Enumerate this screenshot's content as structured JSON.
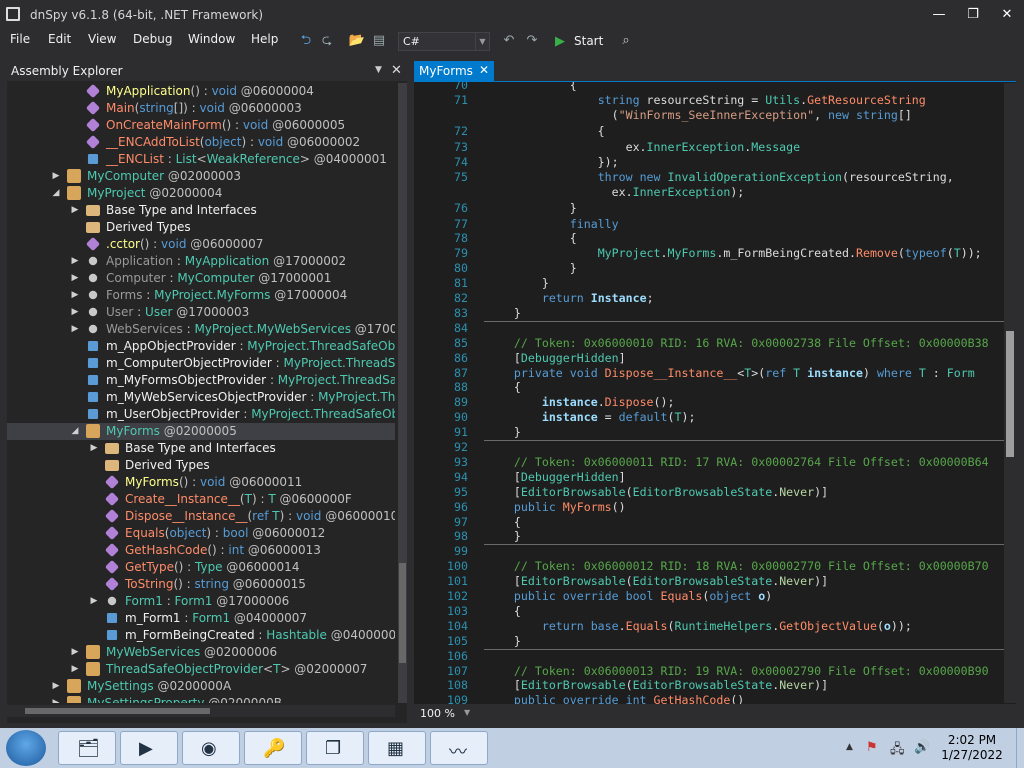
{
  "window": {
    "title": "dnSpy v6.1.8 (64-bit, .NET Framework)",
    "min": "—",
    "max": "❐",
    "close": "✕"
  },
  "menu": [
    "File",
    "Edit",
    "View",
    "Debug",
    "Window",
    "Help"
  ],
  "toolbar": {
    "language": "C#",
    "start_label": "Start"
  },
  "assembly_explorer": {
    "title": "Assembly Explorer",
    "nodes": [
      {
        "indent": 5,
        "arrow": "",
        "icon": "method-icon",
        "color": "#b180d7",
        "parts": [
          [
            "MyApplication",
            "c-m"
          ],
          [
            "() : ",
            "c-p"
          ],
          [
            "void",
            "c-k"
          ],
          [
            " @06000004",
            "c-p"
          ]
        ]
      },
      {
        "indent": 5,
        "arrow": "",
        "icon": "method-icon",
        "color": "#b180d7",
        "parts": [
          [
            "Main",
            "c-mb"
          ],
          [
            "(",
            "c-p"
          ],
          [
            "string",
            "c-k"
          ],
          [
            "[]) : ",
            "c-p"
          ],
          [
            "void",
            "c-k"
          ],
          [
            " @06000003",
            "c-p"
          ]
        ]
      },
      {
        "indent": 5,
        "arrow": "",
        "icon": "method-icon",
        "color": "#b180d7",
        "parts": [
          [
            "OnCreateMainForm",
            "c-mb"
          ],
          [
            "() : ",
            "c-p"
          ],
          [
            "void",
            "c-k"
          ],
          [
            " @06000005",
            "c-p"
          ]
        ]
      },
      {
        "indent": 5,
        "arrow": "",
        "icon": "method-icon",
        "color": "#b180d7",
        "parts": [
          [
            "__ENCAddToList",
            "c-mb"
          ],
          [
            "(",
            "c-p"
          ],
          [
            "object",
            "c-k"
          ],
          [
            ") : ",
            "c-p"
          ],
          [
            "void",
            "c-k"
          ],
          [
            " @06000002",
            "c-p"
          ]
        ]
      },
      {
        "indent": 5,
        "arrow": "",
        "icon": "field-icon",
        "color": "#5b9bd5",
        "parts": [
          [
            "__ENCList",
            "c-mb"
          ],
          [
            " : ",
            "c-p"
          ],
          [
            "List",
            "c-ty"
          ],
          [
            "<",
            "c-p"
          ],
          [
            "WeakReference",
            "c-ty"
          ],
          [
            "> @04000001",
            "c-p"
          ]
        ]
      },
      {
        "indent": 4,
        "arrow": "▶",
        "icon": "class-icon",
        "color": "#d7a65a",
        "parts": [
          [
            "MyComputer",
            "c-ty"
          ],
          [
            " @02000003",
            "c-p"
          ]
        ]
      },
      {
        "indent": 4,
        "arrow": "◢",
        "icon": "class-icon",
        "color": "#d7a65a",
        "parts": [
          [
            "MyProject",
            "c-ty"
          ],
          [
            " @02000004",
            "c-p"
          ]
        ]
      },
      {
        "indent": 5,
        "arrow": "▶",
        "icon": "folder-icon",
        "color": "#dcb67a",
        "parts": [
          [
            "Base Type and Interfaces",
            "c-wh"
          ]
        ]
      },
      {
        "indent": 5,
        "arrow": "",
        "icon": "folder-icon",
        "color": "#dcb67a",
        "parts": [
          [
            "Derived Types",
            "c-wh"
          ]
        ]
      },
      {
        "indent": 5,
        "arrow": "",
        "icon": "method-icon",
        "color": "#b180d7",
        "parts": [
          [
            ".cctor",
            "c-m"
          ],
          [
            "() : ",
            "c-p"
          ],
          [
            "void",
            "c-k"
          ],
          [
            " @06000007",
            "c-p"
          ]
        ]
      },
      {
        "indent": 5,
        "arrow": "▶",
        "icon": "wrench-icon",
        "color": "#c8c8c8",
        "parts": [
          [
            "Application",
            "c-pr"
          ],
          [
            " : ",
            "c-p"
          ],
          [
            "MyApplication",
            "c-ty"
          ],
          [
            " @17000002",
            "c-p"
          ]
        ]
      },
      {
        "indent": 5,
        "arrow": "▶",
        "icon": "wrench-icon",
        "color": "#c8c8c8",
        "parts": [
          [
            "Computer",
            "c-pr"
          ],
          [
            " : ",
            "c-p"
          ],
          [
            "MyComputer",
            "c-ty"
          ],
          [
            " @17000001",
            "c-p"
          ]
        ]
      },
      {
        "indent": 5,
        "arrow": "▶",
        "icon": "wrench-icon",
        "color": "#c8c8c8",
        "parts": [
          [
            "Forms",
            "c-pr"
          ],
          [
            " : ",
            "c-p"
          ],
          [
            "MyProject.MyForms",
            "c-ty"
          ],
          [
            " @17000004",
            "c-p"
          ]
        ]
      },
      {
        "indent": 5,
        "arrow": "▶",
        "icon": "wrench-icon",
        "color": "#c8c8c8",
        "parts": [
          [
            "User",
            "c-pr"
          ],
          [
            " : ",
            "c-p"
          ],
          [
            "User",
            "c-ty"
          ],
          [
            " @17000003",
            "c-p"
          ]
        ]
      },
      {
        "indent": 5,
        "arrow": "▶",
        "icon": "wrench-icon",
        "color": "#c8c8c8",
        "parts": [
          [
            "WebServices",
            "c-pr"
          ],
          [
            " : ",
            "c-p"
          ],
          [
            "MyProject.MyWebServices",
            "c-ty"
          ],
          [
            " @1700000",
            "c-p"
          ]
        ]
      },
      {
        "indent": 5,
        "arrow": "",
        "icon": "field-icon",
        "color": "#5b9bd5",
        "parts": [
          [
            "m_AppObjectProvider",
            "c-wh"
          ],
          [
            " : ",
            "c-p"
          ],
          [
            "MyProject.ThreadSafeObje",
            "c-ty"
          ]
        ]
      },
      {
        "indent": 5,
        "arrow": "",
        "icon": "field-icon",
        "color": "#5b9bd5",
        "parts": [
          [
            "m_ComputerObjectProvider",
            "c-wh"
          ],
          [
            " : ",
            "c-p"
          ],
          [
            "MyProject.ThreadSaf",
            "c-ty"
          ]
        ]
      },
      {
        "indent": 5,
        "arrow": "",
        "icon": "field-icon",
        "color": "#5b9bd5",
        "parts": [
          [
            "m_MyFormsObjectProvider",
            "c-wh"
          ],
          [
            " : ",
            "c-p"
          ],
          [
            "MyProject.ThreadSafe",
            "c-ty"
          ]
        ]
      },
      {
        "indent": 5,
        "arrow": "",
        "icon": "field-icon",
        "color": "#5b9bd5",
        "parts": [
          [
            "m_MyWebServicesObjectProvider",
            "c-wh"
          ],
          [
            " : ",
            "c-p"
          ],
          [
            "MyProject.Thre",
            "c-ty"
          ]
        ]
      },
      {
        "indent": 5,
        "arrow": "",
        "icon": "field-icon",
        "color": "#5b9bd5",
        "parts": [
          [
            "m_UserObjectProvider",
            "c-wh"
          ],
          [
            " : ",
            "c-p"
          ],
          [
            "MyProject.ThreadSafeObje",
            "c-ty"
          ]
        ]
      },
      {
        "indent": 5,
        "arrow": "◢",
        "icon": "class-icon",
        "color": "#d7a65a",
        "sel": true,
        "parts": [
          [
            "MyForms",
            "c-ty"
          ],
          [
            " @02000005",
            "c-p"
          ]
        ]
      },
      {
        "indent": 6,
        "arrow": "▶",
        "icon": "folder-icon",
        "color": "#dcb67a",
        "parts": [
          [
            "Base Type and Interfaces",
            "c-wh"
          ]
        ]
      },
      {
        "indent": 6,
        "arrow": "",
        "icon": "folder-icon",
        "color": "#dcb67a",
        "parts": [
          [
            "Derived Types",
            "c-wh"
          ]
        ]
      },
      {
        "indent": 6,
        "arrow": "",
        "icon": "method-icon",
        "color": "#b180d7",
        "parts": [
          [
            "MyForms",
            "c-m"
          ],
          [
            "() : ",
            "c-p"
          ],
          [
            "void",
            "c-k"
          ],
          [
            " @06000011",
            "c-p"
          ]
        ]
      },
      {
        "indent": 6,
        "arrow": "",
        "icon": "method-icon",
        "color": "#b180d7",
        "parts": [
          [
            "Create__Instance__",
            "c-mb"
          ],
          [
            "(",
            "c-p"
          ],
          [
            "T",
            "c-ty"
          ],
          [
            ") : ",
            "c-p"
          ],
          [
            "T",
            "c-ty"
          ],
          [
            " @0600000F",
            "c-p"
          ]
        ]
      },
      {
        "indent": 6,
        "arrow": "",
        "icon": "method-icon",
        "color": "#b180d7",
        "parts": [
          [
            "Dispose__Instance__",
            "c-mb"
          ],
          [
            "(",
            "c-p"
          ],
          [
            "ref",
            "c-k"
          ],
          [
            " ",
            "c-p"
          ],
          [
            "T",
            "c-ty"
          ],
          [
            ") : ",
            "c-p"
          ],
          [
            "void",
            "c-k"
          ],
          [
            " @06000010",
            "c-p"
          ]
        ]
      },
      {
        "indent": 6,
        "arrow": "",
        "icon": "method-icon",
        "color": "#b180d7",
        "parts": [
          [
            "Equals",
            "c-mb"
          ],
          [
            "(",
            "c-p"
          ],
          [
            "object",
            "c-k"
          ],
          [
            ") : ",
            "c-p"
          ],
          [
            "bool",
            "c-k"
          ],
          [
            " @06000012",
            "c-p"
          ]
        ]
      },
      {
        "indent": 6,
        "arrow": "",
        "icon": "method-icon",
        "color": "#b180d7",
        "parts": [
          [
            "GetHashCode",
            "c-mb"
          ],
          [
            "() : ",
            "c-p"
          ],
          [
            "int",
            "c-k"
          ],
          [
            " @06000013",
            "c-p"
          ]
        ]
      },
      {
        "indent": 6,
        "arrow": "",
        "icon": "method-icon",
        "color": "#b180d7",
        "parts": [
          [
            "GetType",
            "c-mb"
          ],
          [
            "() : ",
            "c-p"
          ],
          [
            "Type",
            "c-ty"
          ],
          [
            " @06000014",
            "c-p"
          ]
        ]
      },
      {
        "indent": 6,
        "arrow": "",
        "icon": "method-icon",
        "color": "#b180d7",
        "parts": [
          [
            "ToString",
            "c-mb"
          ],
          [
            "() : ",
            "c-p"
          ],
          [
            "string",
            "c-k"
          ],
          [
            " @06000015",
            "c-p"
          ]
        ]
      },
      {
        "indent": 6,
        "arrow": "▶",
        "icon": "wrench-icon",
        "color": "#c8c8c8",
        "parts": [
          [
            "Form1",
            "c-ty"
          ],
          [
            " : ",
            "c-p"
          ],
          [
            "Form1",
            "c-ty"
          ],
          [
            " @17000006",
            "c-p"
          ]
        ]
      },
      {
        "indent": 6,
        "arrow": "",
        "icon": "field-icon",
        "color": "#5b9bd5",
        "parts": [
          [
            "m_Form1",
            "c-wh"
          ],
          [
            " : ",
            "c-p"
          ],
          [
            "Form1",
            "c-ty"
          ],
          [
            " @04000007",
            "c-p"
          ]
        ]
      },
      {
        "indent": 6,
        "arrow": "",
        "icon": "field-icon",
        "color": "#5b9bd5",
        "parts": [
          [
            "m_FormBeingCreated",
            "c-wh"
          ],
          [
            " : ",
            "c-p"
          ],
          [
            "Hashtable",
            "c-ty"
          ],
          [
            " @04000008",
            "c-p"
          ]
        ]
      },
      {
        "indent": 5,
        "arrow": "▶",
        "icon": "class-icon",
        "color": "#d7a65a",
        "parts": [
          [
            "MyWebServices",
            "c-ty"
          ],
          [
            " @02000006",
            "c-p"
          ]
        ]
      },
      {
        "indent": 5,
        "arrow": "▶",
        "icon": "generic-class-icon",
        "color": "#d7a65a",
        "parts": [
          [
            "ThreadSafeObjectProvider",
            "c-ty"
          ],
          [
            "<",
            "c-p"
          ],
          [
            "T",
            "c-ty"
          ],
          [
            "> @02000007",
            "c-p"
          ]
        ]
      },
      {
        "indent": 4,
        "arrow": "▶",
        "icon": "class-icon",
        "color": "#d7a65a",
        "parts": [
          [
            "MySettings",
            "c-ty"
          ],
          [
            " @0200000A",
            "c-p"
          ]
        ]
      },
      {
        "indent": 4,
        "arrow": "▶",
        "icon": "class-icon",
        "color": "#d7a65a",
        "parts": [
          [
            "MySettingsProperty",
            "c-ty"
          ],
          [
            " @0200000B",
            "c-p"
          ]
        ]
      }
    ]
  },
  "editor": {
    "tab_label": "MyForms",
    "zoom": "100 %",
    "lines": [
      {
        "n": "70",
        "h": "            {"
      },
      {
        "n": "71",
        "h": "                <k>string</k> resourceString = <ty>Utils</ty>.<mt>GetResourceString</mt>"
      },
      {
        "n": "",
        "h": "                  (<st>\"WinForms_SeeInnerException\"</st>, <k>new string</k>[]"
      },
      {
        "n": "72",
        "h": "                {"
      },
      {
        "n": "73",
        "h": "                    ex.<pr>InnerException</pr>.<pr>Message</pr>"
      },
      {
        "n": "74",
        "h": "                });"
      },
      {
        "n": "75",
        "h": "                <k>throw new</k> <ty>InvalidOperationException</ty>(resourceString,"
      },
      {
        "n": "",
        "h": "                  ex.<pr>InnerException</pr>);"
      },
      {
        "n": "76",
        "h": "            }"
      },
      {
        "n": "77",
        "h": "            <k>finally</k>"
      },
      {
        "n": "78",
        "h": "            {"
      },
      {
        "n": "79",
        "h": "                <ty>MyProject</ty>.<ty>MyForms</ty>.m_FormBeingCreated.<mt>Remove</mt>(<k>typeof</k>(<tg>T</tg>));"
      },
      {
        "n": "80",
        "h": "            }"
      },
      {
        "n": "81",
        "h": "        }"
      },
      {
        "n": "82",
        "h": "        <k>return</k> <pm>Instance</pm>;"
      },
      {
        "n": "83",
        "h": "    }",
        "sep": true
      },
      {
        "n": "84",
        "h": ""
      },
      {
        "n": "85",
        "h": "    <cm>// Token: 0x06000010 RID: 16 RVA: 0x00002738 File Offset: 0x00000B38</cm>"
      },
      {
        "n": "86",
        "h": "    [<ty>DebuggerHidden</ty>]"
      },
      {
        "n": "87",
        "h": "    <k>private void</k> <mt>Dispose__Instance__</mt><<tg>T</tg>>(<k>ref</k> <tg>T</tg> <pm>instance</pm>) <k>where</k> <tg>T</tg> : <ty>Form</ty>"
      },
      {
        "n": "88",
        "h": "    {"
      },
      {
        "n": "89",
        "h": "        <pm>instance</pm>.<mt>Dispose</mt>();"
      },
      {
        "n": "90",
        "h": "        <pm>instance</pm> = <k>default</k>(<tg>T</tg>);"
      },
      {
        "n": "91",
        "h": "    }",
        "sep": true
      },
      {
        "n": "92",
        "h": ""
      },
      {
        "n": "93",
        "h": "    <cm>// Token: 0x06000011 RID: 17 RVA: 0x00002764 File Offset: 0x00000B64</cm>"
      },
      {
        "n": "94",
        "h": "    [<ty>DebuggerHidden</ty>]"
      },
      {
        "n": "95",
        "h": "    [<ty>EditorBrowsable</ty>(<ty>EditorBrowsableState</ty>.<gn>Never</gn>)]"
      },
      {
        "n": "96",
        "h": "    <k>public</k> <mt>MyForms</mt>()"
      },
      {
        "n": "97",
        "h": "    {"
      },
      {
        "n": "98",
        "h": "    }",
        "sep": true
      },
      {
        "n": "99",
        "h": ""
      },
      {
        "n": "100",
        "h": "    <cm>// Token: 0x06000012 RID: 18 RVA: 0x00002770 File Offset: 0x00000B70</cm>"
      },
      {
        "n": "101",
        "h": "    [<ty>EditorBrowsable</ty>(<ty>EditorBrowsableState</ty>.<gn>Never</gn>)]"
      },
      {
        "n": "102",
        "h": "    <k>public override bool</k> <mt>Equals</mt>(<k>object</k> <pm>o</pm>)"
      },
      {
        "n": "103",
        "h": "    {"
      },
      {
        "n": "104",
        "h": "        <k>return base</k>.<mt>Equals</mt>(<ty>RuntimeHelpers</ty>.<mt>GetObjectValue</mt>(<pm>o</pm>));"
      },
      {
        "n": "105",
        "h": "    }",
        "sep": true
      },
      {
        "n": "106",
        "h": ""
      },
      {
        "n": "107",
        "h": "    <cm>// Token: 0x06000013 RID: 19 RVA: 0x00002790 File Offset: 0x00000B90</cm>"
      },
      {
        "n": "108",
        "h": "    [<ty>EditorBrowsable</ty>(<ty>EditorBrowsableState</ty>.<gn>Never</gn>)]"
      },
      {
        "n": "109",
        "h": "    <k>public override int</k> <mt>GetHashCode</mt>()"
      }
    ]
  },
  "taskbar": {
    "apps": [
      "file-explorer-icon",
      "media-player-icon",
      "chrome-icon",
      "key-app-icon",
      "dnspy-window-icon",
      "task-manager-icon",
      "performance-monitor-icon"
    ],
    "time": "2:02 PM",
    "date": "1/27/2022"
  }
}
